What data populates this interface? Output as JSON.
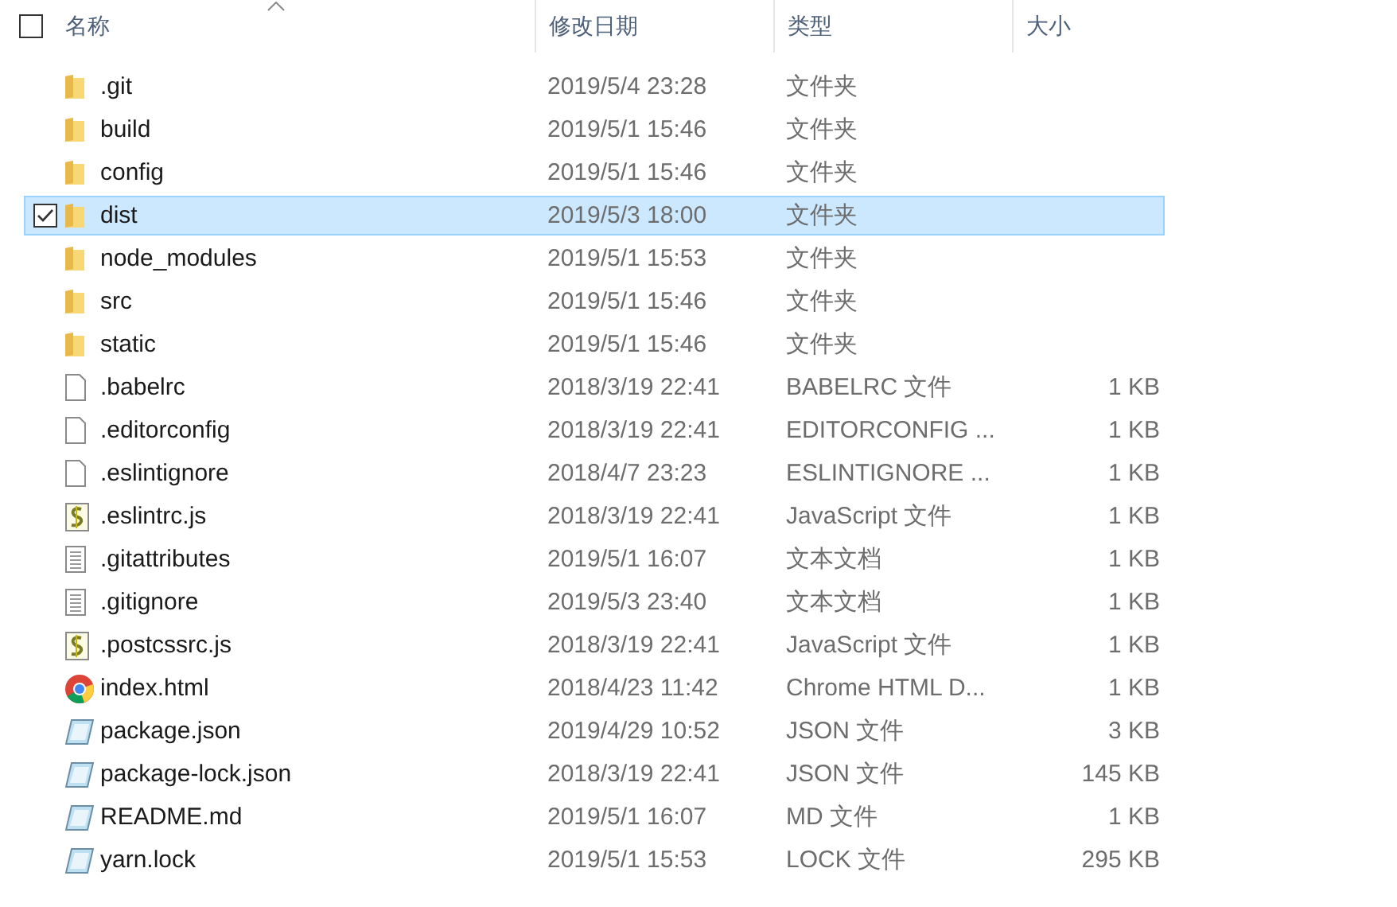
{
  "header": {
    "checked": false,
    "columns": [
      "名称",
      "修改日期",
      "类型",
      "大小"
    ]
  },
  "rows": [
    {
      "name": ".git",
      "date": "2019/5/4 23:28",
      "type": "文件夹",
      "kind": "folder",
      "selected": false
    },
    {
      "name": "build",
      "date": "2019/5/1 15:46",
      "type": "文件夹",
      "kind": "folder",
      "selected": false
    },
    {
      "name": "config",
      "date": "2019/5/1 15:46",
      "type": "文件夹",
      "kind": "folder",
      "selected": false
    },
    {
      "name": "dist",
      "date": "2019/5/3 18:00",
      "type": "文件夹",
      "kind": "folder",
      "selected": true
    },
    {
      "name": "node_modules",
      "date": "2019/5/1 15:53",
      "type": "文件夹",
      "kind": "folder",
      "selected": false
    },
    {
      "name": "src",
      "date": "2019/5/1 15:46",
      "type": "文件夹",
      "kind": "folder",
      "selected": false
    },
    {
      "name": "static",
      "date": "2019/5/1 15:46",
      "type": "文件夹",
      "kind": "folder",
      "selected": false
    },
    {
      "name": ".babelrc",
      "date": "2018/3/19 22:41",
      "type": "BABELRC 文件",
      "size": "1 KB",
      "kind": "file",
      "selected": false
    },
    {
      "name": ".editorconfig",
      "date": "2018/3/19 22:41",
      "type": "EDITORCONFIG ...",
      "size": "1 KB",
      "kind": "file",
      "selected": false
    },
    {
      "name": ".eslintignore",
      "date": "2018/4/7 23:23",
      "type": "ESLINTIGNORE ...",
      "size": "1 KB",
      "kind": "file",
      "selected": false
    },
    {
      "name": ".eslintrc.js",
      "date": "2018/3/19 22:41",
      "type": "JavaScript 文件",
      "size": "1 KB",
      "kind": "script",
      "selected": false
    },
    {
      "name": ".gitattributes",
      "date": "2019/5/1 16:07",
      "type": "文本文档",
      "size": "1 KB",
      "kind": "text",
      "selected": false
    },
    {
      "name": ".gitignore",
      "date": "2019/5/3 23:40",
      "type": "文本文档",
      "size": "1 KB",
      "kind": "text",
      "selected": false
    },
    {
      "name": ".postcssrc.js",
      "date": "2018/3/19 22:41",
      "type": "JavaScript 文件",
      "size": "1 KB",
      "kind": "script",
      "selected": false
    },
    {
      "name": "index.html",
      "date": "2018/4/23 11:42",
      "type": "Chrome HTML D...",
      "size": "1 KB",
      "kind": "browser",
      "selected": false
    },
    {
      "name": "package.json",
      "date": "2019/4/29 10:52",
      "type": "JSON 文件",
      "size": "3 KB",
      "kind": "notepad",
      "selected": false
    },
    {
      "name": "package-lock.json",
      "date": "2018/3/19 22:41",
      "type": "JSON 文件",
      "size": "145 KB",
      "kind": "notepad",
      "selected": false
    },
    {
      "name": "README.md",
      "date": "2019/5/1 16:07",
      "type": "MD 文件",
      "size": "1 KB",
      "kind": "notepad",
      "selected": false
    },
    {
      "name": "yarn.lock",
      "date": "2019/5/1 15:53",
      "type": "LOCK 文件",
      "size": "295 KB",
      "kind": "notepad",
      "selected": false
    }
  ]
}
